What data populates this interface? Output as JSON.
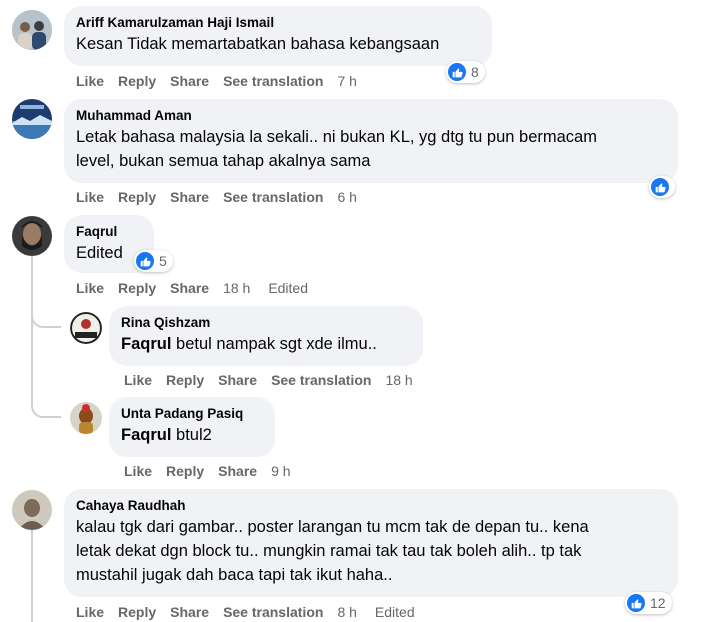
{
  "comments": [
    {
      "author": "Ariff Kamarulzaman Haji Ismail",
      "text": "Kesan Tidak memartabatkan bahasa kebangsaan",
      "actions": {
        "like": "Like",
        "reply": "Reply",
        "share": "Share",
        "see_translation": "See translation",
        "time": "7 h"
      },
      "reactions": {
        "icon": "like-icon",
        "count": "8"
      }
    },
    {
      "author": "Muhammad Aman",
      "text_line1": "Letak bahasa malaysia la sekali.. ni bukan KL, yg dtg tu pun bermacam",
      "text_line2": "level, bukan semua tahap akalnya sama",
      "actions": {
        "like": "Like",
        "reply": "Reply",
        "share": "Share",
        "see_translation": "See translation",
        "time": "6 h"
      },
      "reactions": {
        "icon": "like-icon"
      }
    },
    {
      "author": "Faqrul",
      "text": "Edited",
      "actions": {
        "like": "Like",
        "reply": "Reply",
        "share": "Share",
        "time": "18 h",
        "edited": "Edited"
      },
      "reactions": {
        "icon": "like-icon",
        "count": "5"
      },
      "replies": [
        {
          "author": "Rina Qishzam",
          "mention": "Faqrul",
          "text": "betul nampak sgt xde ilmu..",
          "actions": {
            "like": "Like",
            "reply": "Reply",
            "share": "Share",
            "see_translation": "See translation",
            "time": "18 h"
          }
        },
        {
          "author": "Unta Padang Pasiq",
          "mention": "Faqrul",
          "text": "btul2",
          "actions": {
            "like": "Like",
            "reply": "Reply",
            "share": "Share",
            "time": "9 h"
          }
        }
      ]
    },
    {
      "author": "Cahaya Raudhah",
      "text_line1": "kalau tgk dari gambar.. poster larangan tu mcm tak de depan tu.. kena",
      "text_line2": "letak dekat dgn block tu.. mungkin ramai tak tau tak boleh alih.. tp tak",
      "text_line3": "mustahil jugak dah baca tapi tak ikut haha..",
      "actions": {
        "like": "Like",
        "reply": "Reply",
        "share": "Share",
        "see_translation": "See translation",
        "time": "8 h",
        "edited": "Edited"
      },
      "reactions": {
        "icon": "like-icon",
        "count": "12"
      }
    }
  ]
}
